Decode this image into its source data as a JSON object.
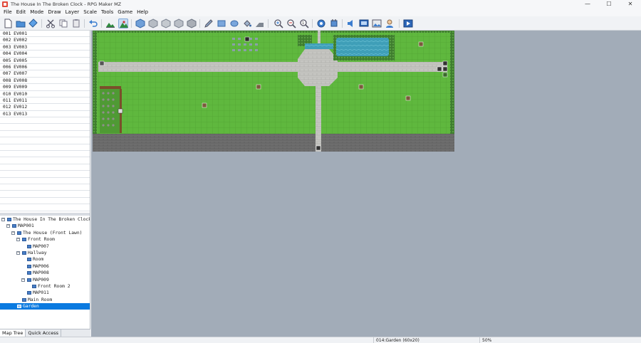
{
  "window": {
    "title": "The House In The Broken Clock - RPG Maker MZ",
    "minimize": "—",
    "maximize": "☐",
    "close": "✕"
  },
  "menu": [
    "File",
    "Edit",
    "Mode",
    "Draw",
    "Layer",
    "Scale",
    "Tools",
    "Game",
    "Help"
  ],
  "events": [
    "001 EV001",
    "002 EV002",
    "003 EV003",
    "004 EV004",
    "005 EV005",
    "006 EV006",
    "007 EV007",
    "008 EV008",
    "009 EV009",
    "010 EV010",
    "011 EV011",
    "012 EV012",
    "013 EV013"
  ],
  "map_tree": [
    {
      "label": "The House In The Broken Clock",
      "level": 0,
      "expander": "−",
      "selected": false
    },
    {
      "label": "MAP001",
      "level": 1,
      "expander": "−",
      "selected": false
    },
    {
      "label": "The House (Front Lawn)",
      "level": 2,
      "expander": "−",
      "selected": false
    },
    {
      "label": "Front Room",
      "level": 3,
      "expander": "−",
      "selected": false
    },
    {
      "label": "MAP007",
      "level": 4,
      "expander": "",
      "selected": false
    },
    {
      "label": "Hallway",
      "level": 3,
      "expander": "−",
      "selected": false
    },
    {
      "label": "Room",
      "level": 4,
      "expander": "",
      "selected": false
    },
    {
      "label": "MAP006",
      "level": 4,
      "expander": "",
      "selected": false
    },
    {
      "label": "MAP008",
      "level": 4,
      "expander": "",
      "selected": false
    },
    {
      "label": "MAP009",
      "level": 4,
      "expander": "−",
      "selected": false
    },
    {
      "label": "Front Room 2",
      "level": 5,
      "expander": "",
      "selected": false
    },
    {
      "label": "MAP011",
      "level": 4,
      "expander": "",
      "selected": false
    },
    {
      "label": "Main Room",
      "level": 3,
      "expander": "",
      "selected": false
    },
    {
      "label": "Garden",
      "level": 2,
      "expander": "",
      "selected": true
    }
  ],
  "tabs": {
    "map_tree": "Map Tree",
    "quick_access": "Quick Access"
  },
  "status": {
    "map": "014:Garden (60x20)",
    "zoom": "50%"
  },
  "colors": {
    "grass": "#5fb83e",
    "path": "#c4c4c0",
    "water": "#3f9fb8",
    "selected": "#0a7ae0"
  }
}
